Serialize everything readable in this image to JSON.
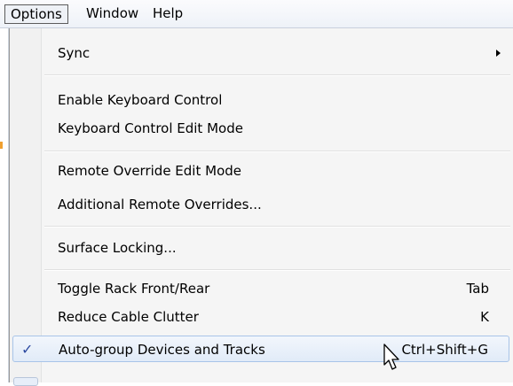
{
  "menubar": {
    "items": [
      {
        "label": "Options",
        "active": true
      },
      {
        "label": "Window"
      },
      {
        "label": "Help"
      }
    ]
  },
  "menu": {
    "items": [
      {
        "label": "Sync",
        "has_submenu": true
      },
      {
        "label": "Enable Keyboard Control"
      },
      {
        "label": "Keyboard Control Edit Mode"
      },
      {
        "label": "Remote Override Edit Mode"
      },
      {
        "label": "Additional Remote Overrides..."
      },
      {
        "label": "Surface Locking..."
      },
      {
        "label": "Toggle Rack Front/Rear",
        "shortcut": "Tab"
      },
      {
        "label": "Reduce Cable Clutter",
        "shortcut": "K"
      },
      {
        "label": "Auto-group Devices and Tracks",
        "shortcut": "Ctrl+Shift+G",
        "checked": true,
        "highlighted": true
      }
    ],
    "check_glyph": "✓"
  },
  "colors": {
    "menu_background": "#f5f5f5",
    "highlight_border": "#a8c4e8",
    "check_color": "#2d4aa0"
  },
  "icons": {
    "submenu": "chevron-right-icon",
    "checked": "check-icon",
    "pointer": "mouse-pointer-icon"
  }
}
